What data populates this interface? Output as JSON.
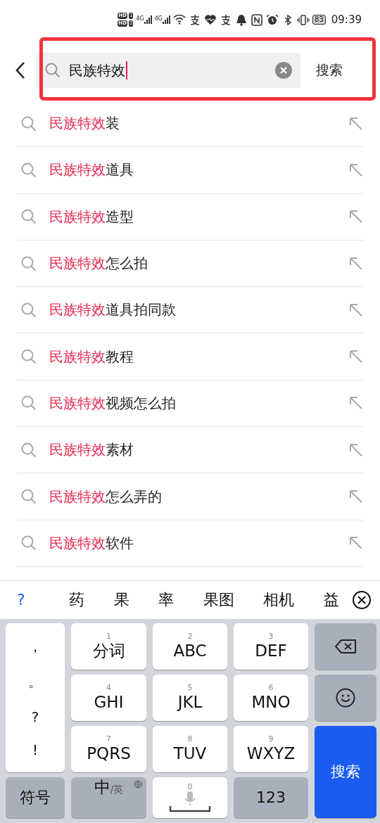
{
  "status_bar": {
    "sim_badges": [
      {
        "label": "HD",
        "slot": "1"
      },
      {
        "label": "HD",
        "slot": "2"
      }
    ],
    "network": [
      "4G",
      "4G"
    ],
    "battery": "83",
    "time": "09:39"
  },
  "search": {
    "value": "民族特效",
    "button": "搜索",
    "highlighted": true
  },
  "suggestions": [
    {
      "match": "民族特效",
      "rest": "装"
    },
    {
      "match": "民族特效",
      "rest": "道具"
    },
    {
      "match": "民族特效",
      "rest": "造型"
    },
    {
      "match": "民族特效",
      "rest": "怎么拍"
    },
    {
      "match": "民族特效",
      "rest": "道具拍同款"
    },
    {
      "match": "民族特效",
      "rest": "教程"
    },
    {
      "match": "民族特效",
      "rest": "视频怎么拍"
    },
    {
      "match": "民族特效",
      "rest": "素材"
    },
    {
      "match": "民族特效",
      "rest": "怎么弄的"
    },
    {
      "match": "民族特效",
      "rest": "软件"
    }
  ],
  "candidates": {
    "help": "?",
    "words": [
      "药",
      "果",
      "率",
      "果图",
      "相机",
      "益"
    ]
  },
  "keyboard": {
    "punctuation": [
      "，",
      "。",
      "?",
      "!"
    ],
    "keys": [
      {
        "kind": "letter",
        "number": "1",
        "label": "分词"
      },
      {
        "kind": "letter",
        "number": "2",
        "label": "ABC"
      },
      {
        "kind": "letter",
        "number": "3",
        "label": "DEF"
      },
      {
        "kind": "backspace"
      },
      {
        "kind": "letter",
        "number": "4",
        "label": "GHI"
      },
      {
        "kind": "letter",
        "number": "5",
        "label": "JKL"
      },
      {
        "kind": "letter",
        "number": "6",
        "label": "MNO"
      },
      {
        "kind": "emoji"
      },
      {
        "kind": "letter",
        "number": "7",
        "label": "PQRS"
      },
      {
        "kind": "letter",
        "number": "8",
        "label": "TUV"
      },
      {
        "kind": "letter",
        "number": "9",
        "label": "WXYZ"
      },
      {
        "kind": "enter",
        "label": "搜索"
      },
      {
        "kind": "function",
        "label": "符号"
      },
      {
        "kind": "language",
        "label": "中",
        "sub": "/英"
      },
      {
        "kind": "space",
        "number": "0"
      },
      {
        "kind": "function",
        "label": "123"
      }
    ]
  }
}
